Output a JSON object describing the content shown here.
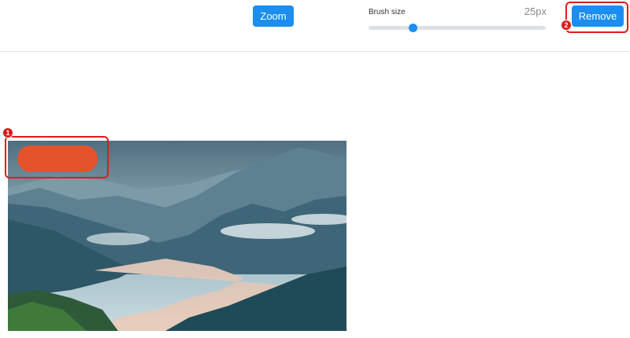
{
  "toolbar": {
    "zoom_label": "Zoom",
    "brush": {
      "label": "Brush size",
      "value_text": "25px",
      "slider_fraction": 0.25
    },
    "remove_label": "Remove"
  },
  "annotations": {
    "marker_1": "1",
    "marker_2": "2"
  },
  "canvas": {
    "brush_stroke_color": "#e5532c"
  },
  "colors": {
    "accent": "#1b8ef0",
    "annotation": "#e01b1b"
  }
}
